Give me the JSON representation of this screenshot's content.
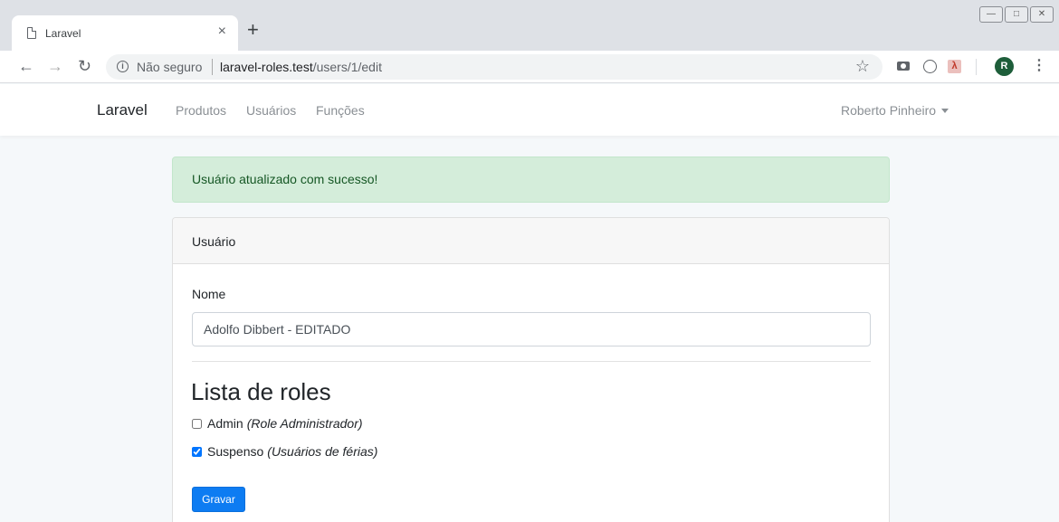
{
  "browser": {
    "tab_title": "Laravel",
    "tab_close": "×",
    "new_tab": "+",
    "security_text": "Não seguro",
    "url_host": "laravel-roles.test",
    "url_path": "/users/1/edit",
    "profile_initial": "R"
  },
  "navbar": {
    "brand": "Laravel",
    "links": [
      "Produtos",
      "Usuários",
      "Funções"
    ],
    "user_name": "Roberto Pinheiro"
  },
  "alert": {
    "message": "Usuário atualizado com sucesso!"
  },
  "card": {
    "header": "Usuário",
    "name_label": "Nome",
    "name_value": "Adolfo Dibbert - EDITADO",
    "roles_title": "Lista de roles",
    "roles": [
      {
        "name": "Admin",
        "description": "(Role Administrador)",
        "checked": false
      },
      {
        "name": "Suspenso",
        "description": "(Usuários de férias)",
        "checked": true
      }
    ],
    "save_label": "Gravar"
  },
  "colors": {
    "primary": "#0d7cf2",
    "alert_bg": "#d4edda",
    "alert_text": "#155724"
  }
}
